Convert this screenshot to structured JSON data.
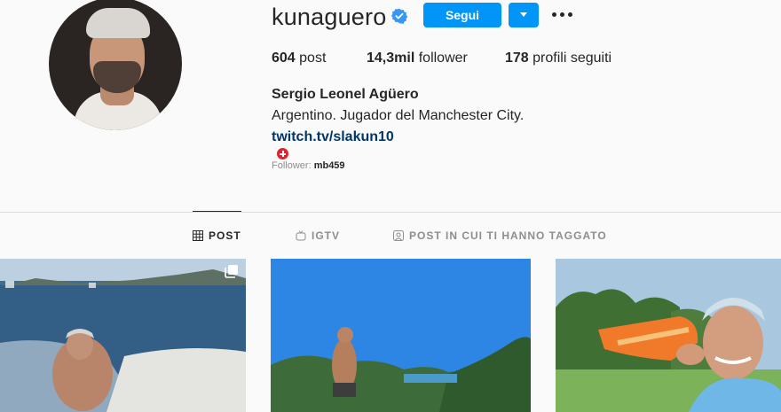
{
  "profile": {
    "username": "kunaguero",
    "full_name": "Sergio Leonel Agüero",
    "bio": "Argentino. Jugador del Manchester City.",
    "link": "twitch.tv/slakun10",
    "followed_by_label": "Follower:",
    "followed_by_user": "mb459"
  },
  "actions": {
    "follow_label": "Segui"
  },
  "stats": {
    "posts_value": "604",
    "posts_label": "post",
    "followers_value": "14,3mil",
    "followers_label": "follower",
    "following_value": "178",
    "following_label": "profili seguiti"
  },
  "tabs": [
    {
      "label": "POST",
      "icon": "grid-icon",
      "active": true
    },
    {
      "label": "IGTV",
      "icon": "igtv-icon",
      "active": false
    },
    {
      "label": "POST IN CUI TI HANNO TAGGATO",
      "icon": "tagged-icon",
      "active": false
    }
  ],
  "colors": {
    "accent": "#0095f6",
    "link": "#00376b",
    "verified": "#3897f0",
    "muted": "#8e8e8e"
  }
}
